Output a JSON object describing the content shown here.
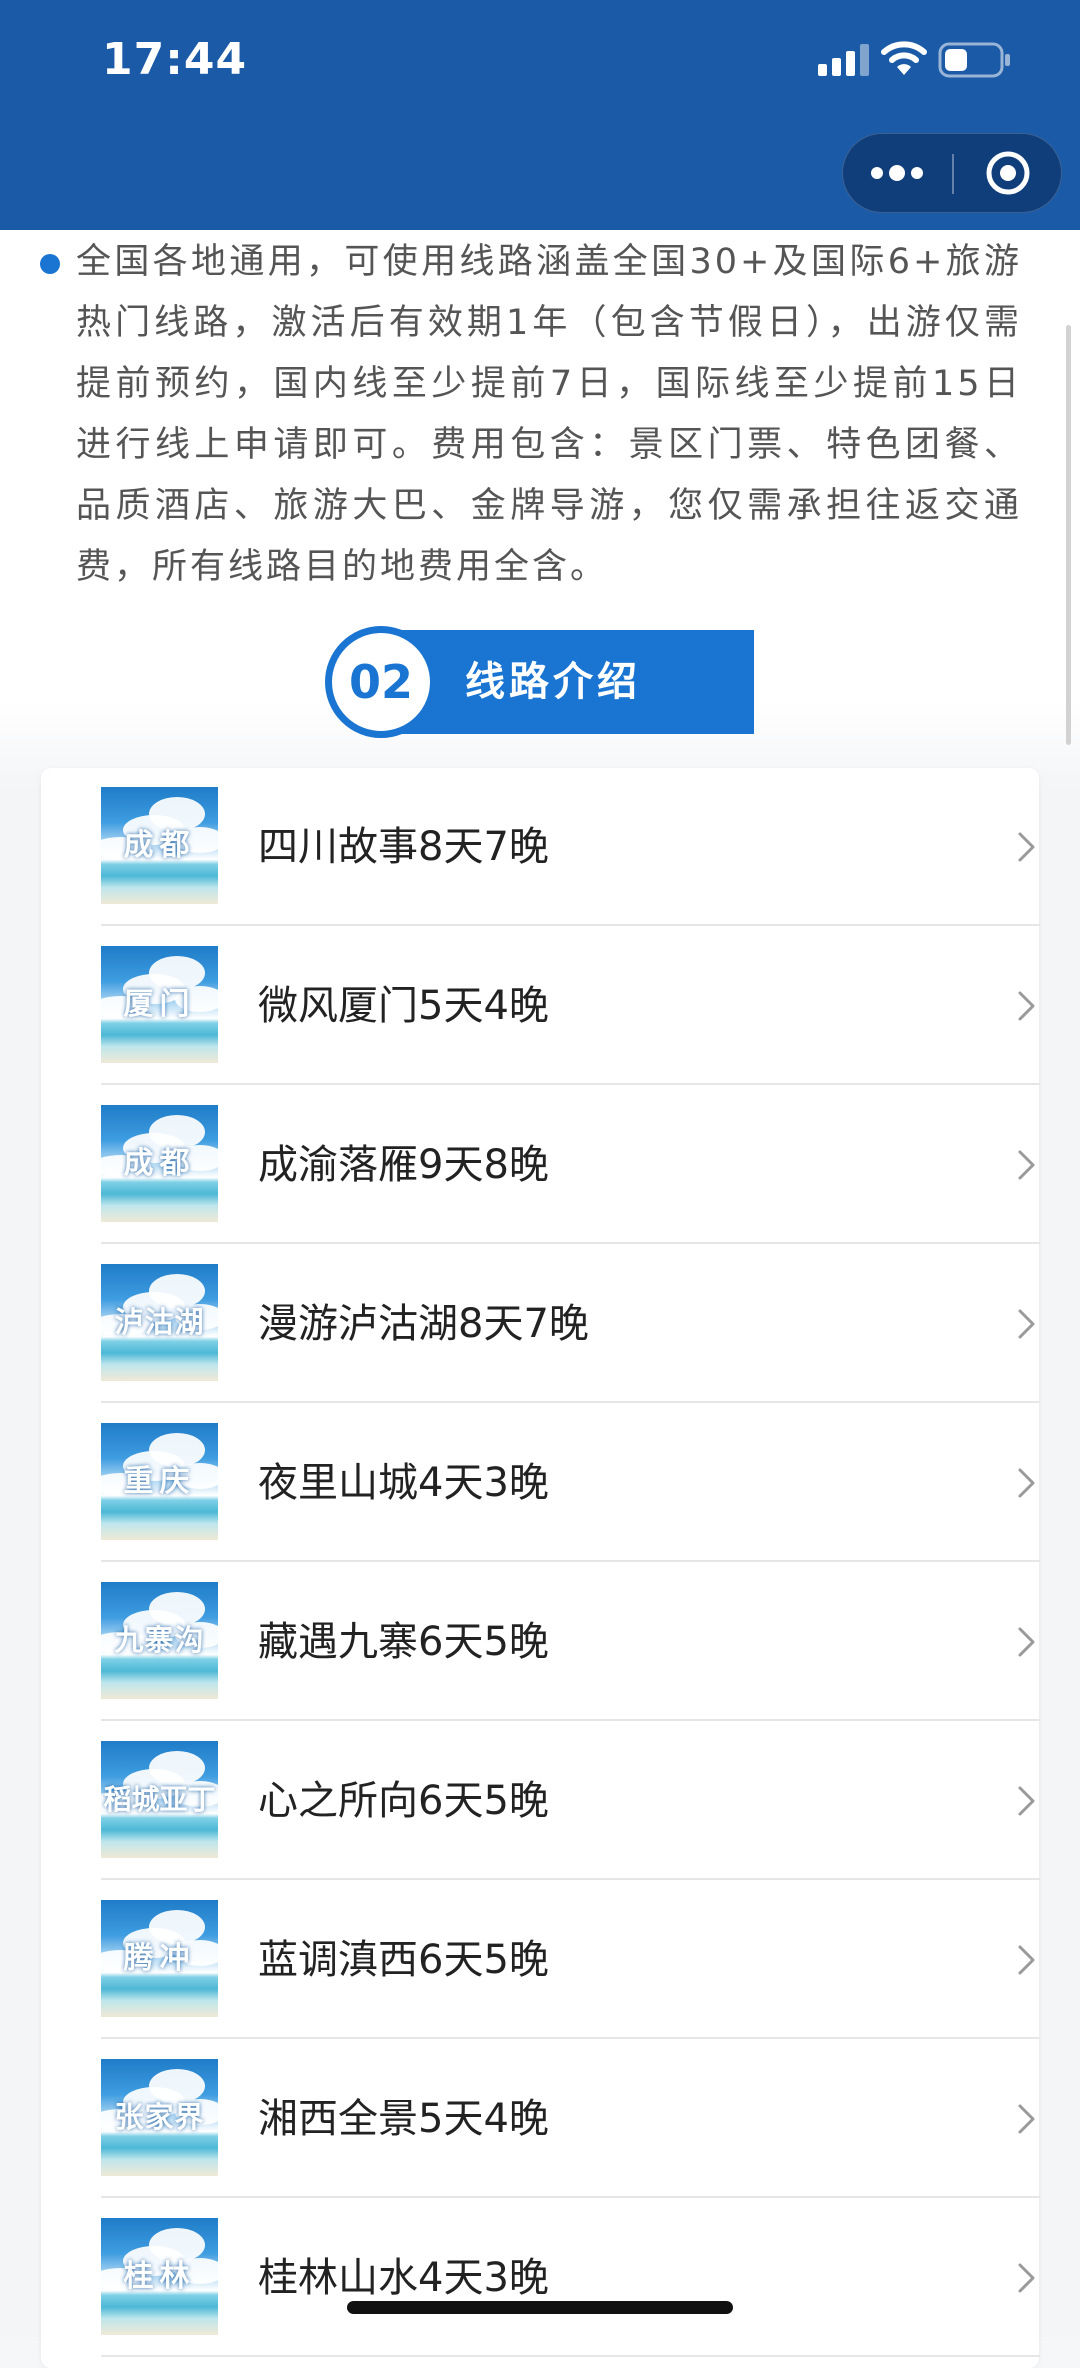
{
  "status_bar": {
    "time": "17:44",
    "icons": [
      "cellular-signal-icon",
      "wifi-icon",
      "battery-icon"
    ]
  },
  "nav": {
    "more_icon": "more-dots-icon",
    "close_icon": "target-close-icon"
  },
  "description": {
    "text": "全国各地通用，可使用线路涵盖全国30+及国际6+旅游热门线路，激活后有效期1年（包含节假日），出游仅需提前预约，国内线至少提前7日，国际线至少提前15日进行线上申请即可。费用包含：景区门票、特色团餐、品质酒店、旅游大巴、金牌导游，您仅需承担往返交通费，所有线路目的地费用全含。"
  },
  "section": {
    "number": "02",
    "title": "线路介绍"
  },
  "routes": [
    {
      "thumb": "成都",
      "name": "四川故事8天7晚"
    },
    {
      "thumb": "厦门",
      "name": "微风厦门5天4晚"
    },
    {
      "thumb": "成都",
      "name": "成渝落雁9天8晚"
    },
    {
      "thumb": "泸沽湖",
      "name": "漫游泸沽湖8天7晚"
    },
    {
      "thumb": "重庆",
      "name": "夜里山城4天3晚"
    },
    {
      "thumb": "九寨沟",
      "name": "藏遇九寨6天5晚"
    },
    {
      "thumb": "稻城亚丁",
      "name": "心之所向6天5晚"
    },
    {
      "thumb": "腾冲",
      "name": "蓝调滇西6天5晚"
    },
    {
      "thumb": "张家界",
      "name": "湘西全景5天4晚"
    },
    {
      "thumb": "桂林",
      "name": "桂林山水4天3晚"
    }
  ],
  "colors": {
    "nav_bg": "#1b5aa6",
    "accent": "#1a75d2",
    "text_body": "#555555",
    "text_title": "#222222"
  }
}
